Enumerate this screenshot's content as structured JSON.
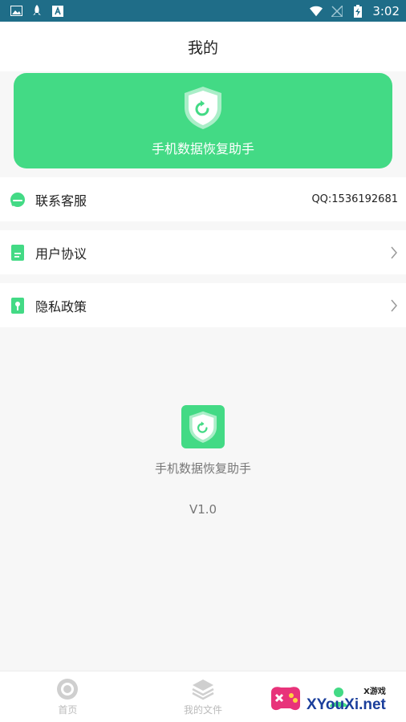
{
  "status_bar": {
    "time": "3:02",
    "icons_left": [
      "image-icon",
      "rocket-icon",
      "text-a-icon"
    ],
    "icons_right": [
      "wifi-icon",
      "no-signal-icon",
      "battery-charging-icon"
    ]
  },
  "header": {
    "title": "我的"
  },
  "hero": {
    "title": "手机数据恢复助手",
    "background": "#43da85"
  },
  "rows": {
    "contact": {
      "label": "联系客服",
      "value": "QQ:1536192681"
    },
    "agreement": {
      "label": "用户协议"
    },
    "privacy": {
      "label": "隐私政策"
    }
  },
  "about": {
    "app_name": "手机数据恢复助手",
    "version": "V1.0"
  },
  "bottom_nav": {
    "items": [
      {
        "label": "首页",
        "icon": "home-icon"
      },
      {
        "label": "我的文件",
        "icon": "layers-icon"
      },
      {
        "label": "",
        "icon": "profile-icon"
      }
    ]
  },
  "watermark": {
    "small": "X游戏",
    "big": "XYouXi.net"
  },
  "colors": {
    "accent": "#43da85",
    "status_bar": "#1f6d88"
  }
}
